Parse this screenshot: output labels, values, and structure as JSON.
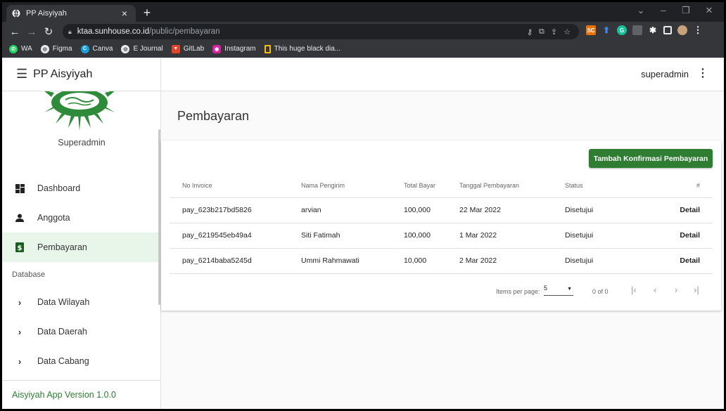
{
  "browser": {
    "tab_title": "PP Aisyiyah",
    "url_host": "ktaa.sunhouse.co.id",
    "url_path": "/public/pembayaran",
    "bookmarks": [
      {
        "label": "WA",
        "icon": "whatsapp-icon",
        "color": "#25d366"
      },
      {
        "label": "Figma",
        "icon": "globe-icon",
        "color": "#5f6368"
      },
      {
        "label": "Canva",
        "icon": "canva-icon",
        "color": "#1a9ed9"
      },
      {
        "label": "E Journal",
        "icon": "globe-icon",
        "color": "#5f6368"
      },
      {
        "label": "GitLab",
        "icon": "gitlab-icon",
        "color": "#e24329"
      },
      {
        "label": "Instagram",
        "icon": "instagram-icon",
        "color": "#d6249f"
      },
      {
        "label": "This huge black dia...",
        "icon": "bookmark-icon",
        "color": "#fbbc04"
      }
    ]
  },
  "header": {
    "app_title": "PP Aisyiyah",
    "user": "superadmin"
  },
  "sidebar": {
    "role": "Superadmin",
    "items": [
      {
        "label": "Dashboard",
        "icon": "dashboard-icon",
        "active": false
      },
      {
        "label": "Anggota",
        "icon": "person-icon",
        "active": false
      },
      {
        "label": "Pembayaran",
        "icon": "payment-icon",
        "active": true
      }
    ],
    "section_label": "Database",
    "db_items": [
      {
        "label": "Data Wilayah"
      },
      {
        "label": "Data Daerah"
      },
      {
        "label": "Data Cabang"
      }
    ],
    "version": "Aisyiyah App Version 1.0.0"
  },
  "main": {
    "title": "Pembayaran",
    "add_button": "Tambah Konfirmasi Pembayaran",
    "table": {
      "headers": [
        "No Invoice",
        "Nama Pengirim",
        "Total Bayar",
        "Tanggal Pembayaran",
        "Status",
        "#"
      ],
      "rows": [
        [
          "pay_623b217bd5826",
          "arvian",
          "100,000",
          "22 Mar 2022",
          "Disetujui",
          "Detail"
        ],
        [
          "pay_6219545eb49a4",
          "Siti Fatimah",
          "100,000",
          "1 Mar 2022",
          "Disetujui",
          "Detail"
        ],
        [
          "pay_6214baba5245d",
          "Ummi Rahmawati",
          "10,000",
          "2 Mar 2022",
          "Disetujui",
          "Detail"
        ]
      ]
    },
    "paginator": {
      "items_per_page_label": "Items per page:",
      "page_size": "5",
      "range": "0 of 0"
    }
  },
  "colors": {
    "primary": "#2e7d32",
    "active_bg": "#e8f5e9"
  }
}
